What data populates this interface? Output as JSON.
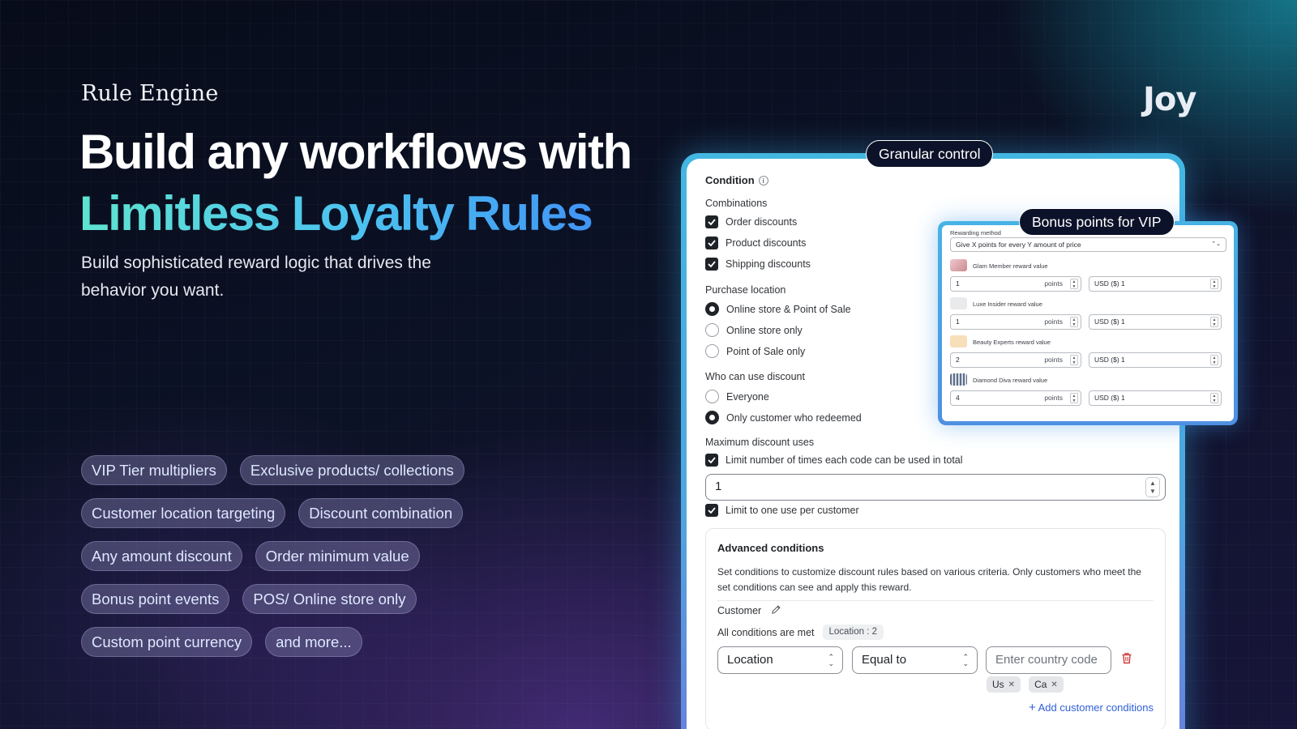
{
  "hero": {
    "eyebrow": "Rule Engine",
    "headline_line1": "Build any workflows with",
    "headline_line2": "Limitless Loyalty Rules",
    "subhead": "Build sophisticated reward logic that drives the behavior you want."
  },
  "features": [
    [
      "VIP Tier multipliers",
      "Exclusive products/ collections"
    ],
    [
      "Customer location targeting",
      "Discount combination"
    ],
    [
      "Any amount discount",
      "Order minimum value"
    ],
    [
      "Bonus point events",
      "POS/ Online store only"
    ],
    [
      "Custom point currency",
      "and more..."
    ]
  ],
  "logo": "Joy",
  "colors": {
    "accent_gradient_start": "#5fe3d0",
    "accent_gradient_end": "#3f8df5",
    "panel_border": "#42b7e2",
    "link": "#2f5fd9",
    "delete": "#d23a3a"
  },
  "panel": {
    "pill": "Granular control",
    "title": "Condition",
    "combinations": {
      "label": "Combinations",
      "items": [
        "Order discounts",
        "Product discounts",
        "Shipping discounts"
      ]
    },
    "purchase_location": {
      "label": "Purchase location",
      "options": [
        "Online store & Point of Sale",
        "Online store only",
        "Point of Sale only"
      ],
      "selected": "Online store & Point of Sale"
    },
    "who_can_use": {
      "label": "Who can use discount",
      "options": [
        "Everyone",
        "Only customer who redeemed"
      ],
      "selected": "Only customer who redeemed"
    },
    "max_uses": {
      "label": "Maximum discount uses",
      "limit_total_label": "Limit number of times each code can be used in total",
      "limit_total_value": "1",
      "limit_per_customer_label": "Limit to one use per customer"
    },
    "advanced": {
      "title": "Advanced conditions",
      "description": "Set conditions to customize discount rules based on various criteria. Only customers who meet the set conditions can see and apply this reward.",
      "customer_label": "Customer",
      "all_met_label": "All conditions are met",
      "location_badge": "Location : 2",
      "field_select": "Location",
      "operator_select": "Equal to",
      "country_placeholder": "Enter country code",
      "tags": [
        "Us",
        "Ca"
      ],
      "add_link": "Add customer conditions"
    }
  },
  "vip": {
    "pill": "Bonus points for VIP",
    "rewarding_method_label": "Rewarding method",
    "rewarding_method_value": "Give X points for every Y amount of price",
    "tiers": [
      {
        "name": "Glam Member reward value",
        "points": "1",
        "unit": "points",
        "price": "USD ($) 1"
      },
      {
        "name": "Luxe Insider reward value",
        "points": "1",
        "unit": "points",
        "price": "USD ($) 1"
      },
      {
        "name": "Beauty Experts reward value",
        "points": "2",
        "unit": "points",
        "price": "USD ($) 1"
      },
      {
        "name": "Diamond Diva reward value",
        "points": "4",
        "unit": "points",
        "price": "USD ($) 1"
      }
    ]
  }
}
